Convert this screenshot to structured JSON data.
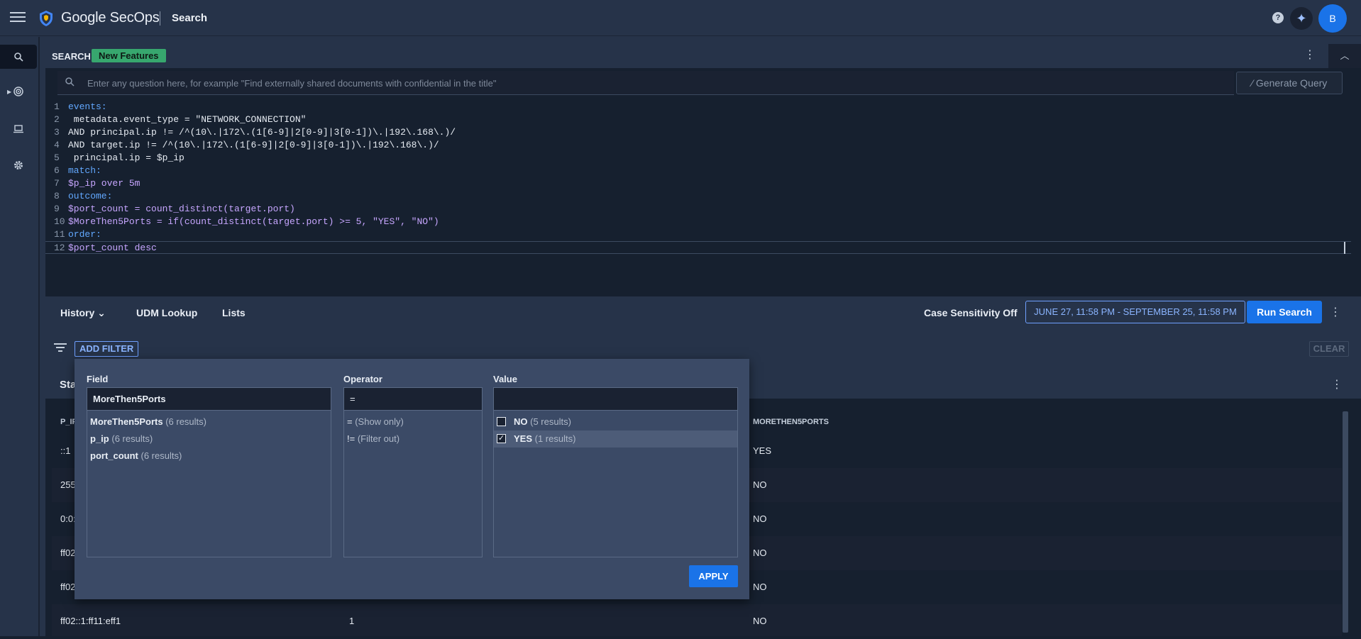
{
  "app": {
    "brand": "Google SecOps",
    "page_title": "Search",
    "avatar_initial": "B",
    "help_icon": "help-icon",
    "accent_color": "#1a73e8"
  },
  "search": {
    "title": "SEARCH",
    "badge": "New Features",
    "query_placeholder": "Enter any question here, for example \"Find externally shared documents with confidential in the title\"",
    "generate_query_label": "Generate Query",
    "code_lines": [
      "events:",
      " metadata.event_type = \"NETWORK_CONNECTION\"",
      "AND principal.ip != /^(10\\.|172\\.(1[6-9]|2[0-9]|3[0-1])\\.|192\\.168\\.)/",
      "AND target.ip != /^(10\\.|172\\.(1[6-9]|2[0-9]|3[0-1])\\.|192\\.168\\.)/",
      " principal.ip = $p_ip",
      "match:",
      "$p_ip over 5m",
      "outcome:",
      "$port_count = count_distinct(target.port)",
      "$MoreThen5Ports = if(count_distinct(target.port) >= 5, \"YES\", \"NO\")",
      "order:",
      "$port_count desc"
    ],
    "line_numbers": [
      "1",
      "2",
      "3",
      "4",
      "5",
      "6",
      "7",
      "8",
      "9",
      "10",
      "11",
      "12"
    ]
  },
  "footer": {
    "history_label": "History",
    "udm_lookup_label": "UDM Lookup",
    "lists_label": "Lists",
    "case_sensitivity": "Case Sensitivity Off",
    "date_range": "JUNE 27, 11:58 PM - SEPTEMBER 25, 11:58 PM",
    "run_search_label": "Run Search"
  },
  "filter_bar": {
    "add_filter_label": "ADD FILTER",
    "clear_label": "CLEAR"
  },
  "results": {
    "title": "Sta",
    "columns": [
      "P_IP",
      "MORETHEN5PORTS"
    ],
    "rows": [
      {
        "p_ip": "::1",
        "port_count": "",
        "more": "YES"
      },
      {
        "p_ip": "255",
        "port_count": "",
        "more": "NO"
      },
      {
        "p_ip": "0:0:",
        "port_count": "",
        "more": "NO"
      },
      {
        "p_ip": "ff02",
        "port_count": "",
        "more": "NO"
      },
      {
        "p_ip": "ff02",
        "port_count": "",
        "more": "NO"
      },
      {
        "p_ip": "ff02::1:ff11:eff1",
        "port_count": "1",
        "more": "NO"
      }
    ]
  },
  "filter_popup": {
    "field_label": "Field",
    "operator_label": "Operator",
    "value_label": "Value",
    "field_value": "MoreThen5Ports",
    "operator_value": "=",
    "value_value": "",
    "fields": [
      {
        "name": "MoreThen5Ports",
        "count": "(6 results)"
      },
      {
        "name": "p_ip",
        "count": "(6 results)"
      },
      {
        "name": "port_count",
        "count": "(6 results)"
      }
    ],
    "operators": [
      {
        "symbol": "=",
        "desc": "(Show only)"
      },
      {
        "symbol": "!=",
        "desc": "(Filter out)"
      }
    ],
    "values": [
      {
        "name": "NO",
        "count": "(5 results)",
        "checked": false
      },
      {
        "name": "YES",
        "count": "(1 results)",
        "checked": true
      }
    ],
    "apply_label": "APPLY"
  }
}
